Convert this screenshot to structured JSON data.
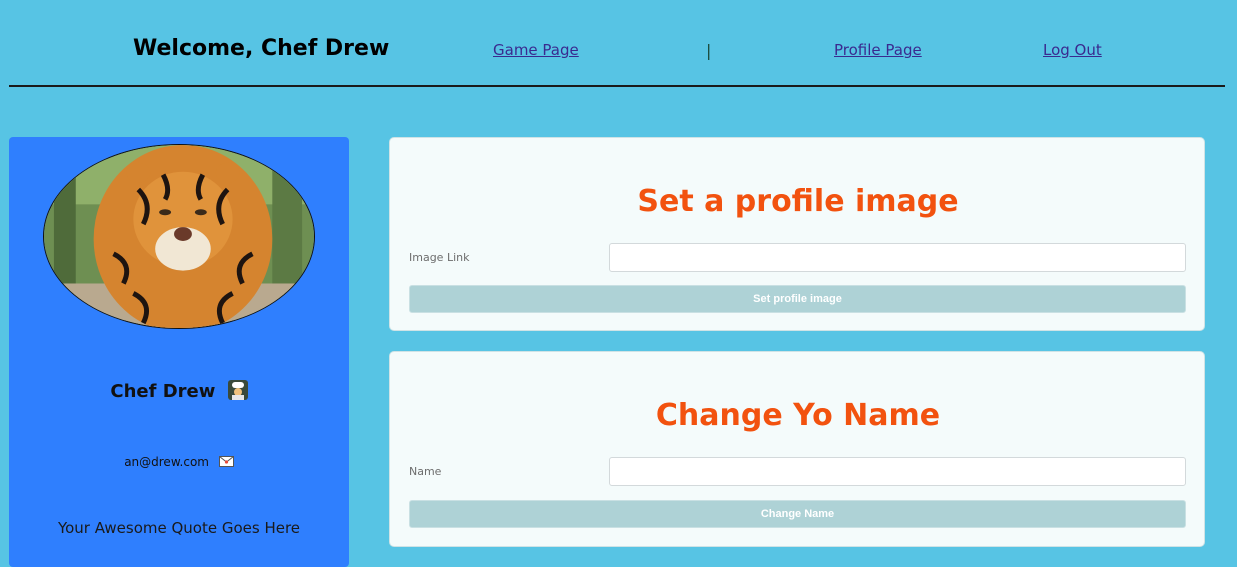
{
  "header": {
    "welcome": "Welcome, Chef Drew",
    "nav": {
      "game_page": "Game Page",
      "separator": "|",
      "profile_page": "Profile Page",
      "log_out": "Log Out"
    }
  },
  "profile": {
    "avatar_icon": "tiger-photo",
    "name": "Chef Drew",
    "name_emoji_icon": "chef-emoji-icon",
    "email": "an@drew.com",
    "email_emoji_icon": "envelope-emoji-icon",
    "quote": "Your Awesome Quote Goes Here"
  },
  "image_form": {
    "title": "Set a profile image",
    "label": "Image Link",
    "value": "",
    "button": "Set profile image"
  },
  "name_form": {
    "title": "Change Yo Name",
    "label": "Name",
    "value": "",
    "button": "Change Name"
  },
  "colors": {
    "page_background": "#57c4e4",
    "profile_card": "#2f7ffe",
    "panel_title": "#f2520f",
    "button": "#aed2d6"
  }
}
